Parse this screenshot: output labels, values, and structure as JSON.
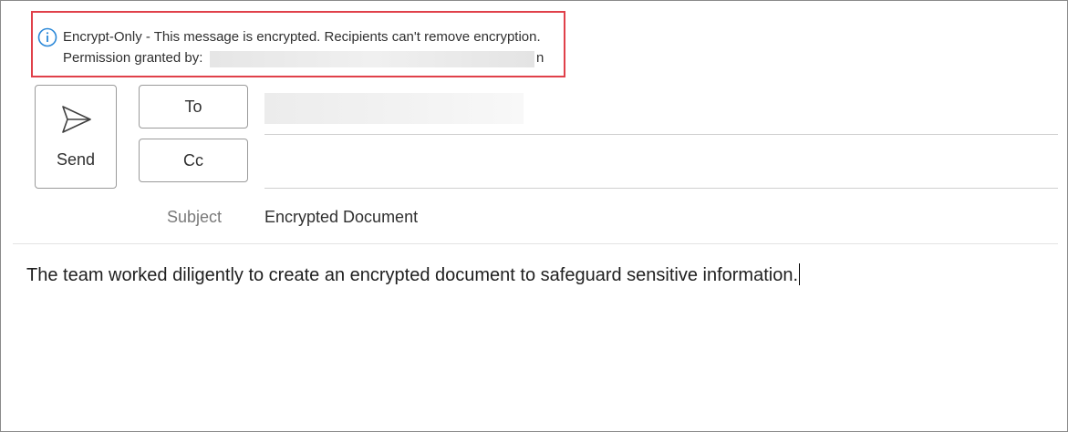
{
  "banner": {
    "line1": "Encrypt-Only - This message is encrypted. Recipients can't remove encryption.",
    "line2_label": "Permission granted by:",
    "line2_tail": "n"
  },
  "compose": {
    "send_label": "Send",
    "to_label": "To",
    "cc_label": "Cc",
    "subject_label": "Subject",
    "subject_value": "Encrypted Document"
  },
  "body": {
    "text": "The team worked diligently to create an encrypted document to safeguard sensitive information."
  },
  "colors": {
    "banner_border": "#e0404a",
    "info_icon": "#2b88d8"
  },
  "icons": [
    "info-icon",
    "send-icon"
  ]
}
